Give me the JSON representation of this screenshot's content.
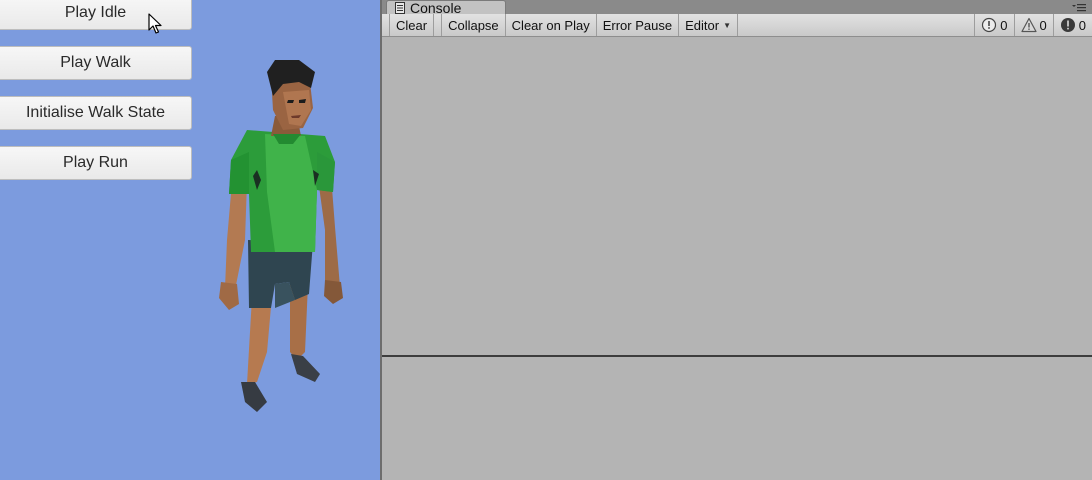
{
  "game": {
    "buttons": {
      "play_idle": "Play Idle",
      "play_walk": "Play Walk",
      "init_walk": "Initialise Walk State",
      "play_run": "Play Run"
    },
    "background_color": "#7c9bde"
  },
  "console": {
    "tab_label": "Console",
    "tab_icon": "console-icon",
    "toolbar": {
      "clear": "Clear",
      "collapse": "Collapse",
      "clear_on_play": "Clear on Play",
      "error_pause": "Error Pause",
      "editor": "Editor",
      "info_count": "0",
      "warning_count": "0",
      "error_count": "0"
    },
    "icons": [
      "info-icon",
      "warning-icon",
      "error-icon",
      "menu-icon"
    ]
  }
}
